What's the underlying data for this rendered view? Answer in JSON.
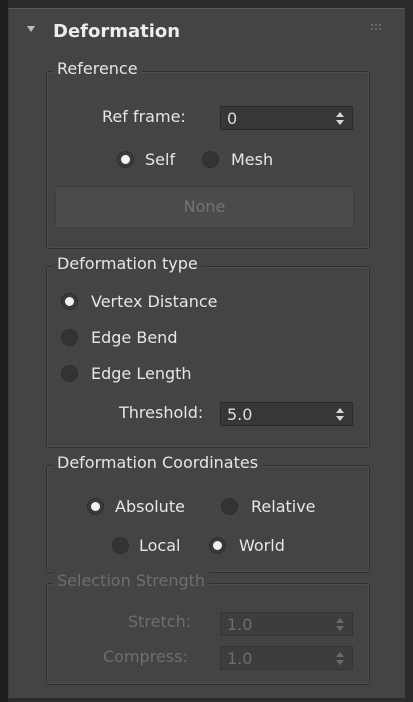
{
  "rollout": {
    "title": "Deformation"
  },
  "reference": {
    "title": "Reference",
    "ref_frame_label": "Ref frame:",
    "ref_frame_value": "0",
    "radio_self": "Self",
    "radio_mesh": "Mesh",
    "selected": "Self",
    "none_button": "None"
  },
  "deformation_type": {
    "title": "Deformation type",
    "options": [
      "Vertex Distance",
      "Edge Bend",
      "Edge Length"
    ],
    "selected": "Vertex Distance",
    "threshold_label": "Threshold:",
    "threshold_value": "5.0"
  },
  "deformation_coordinates": {
    "title": "Deformation Coordinates",
    "absolute": "Absolute",
    "relative": "Relative",
    "local": "Local",
    "world": "World",
    "selected_mode": "Absolute",
    "selected_space": "World"
  },
  "selection_strength": {
    "title": "Selection Strength",
    "stretch_label": "Stretch:",
    "stretch_value": "1.0",
    "compress_label": "Compress:",
    "compress_value": "1.0",
    "enabled": false
  }
}
